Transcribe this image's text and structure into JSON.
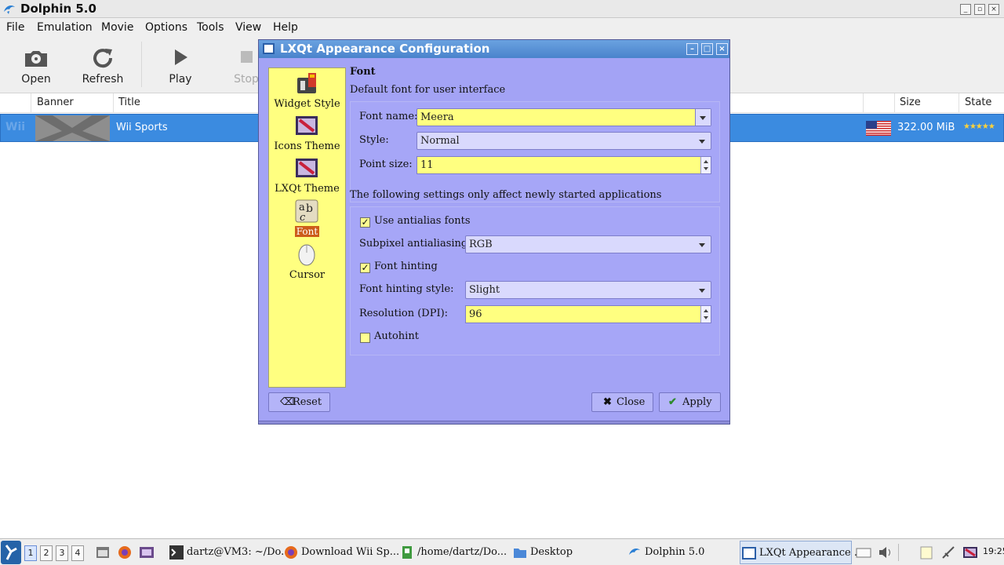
{
  "dolphin": {
    "title": "Dolphin 5.0",
    "menu": [
      "File",
      "Emulation",
      "Movie",
      "Options",
      "Tools",
      "View",
      "Help"
    ],
    "toolbar": {
      "open": "Open",
      "refresh": "Refresh",
      "play": "Play",
      "stop": "Stop"
    },
    "columns": {
      "banner": "Banner",
      "title": "Title",
      "size": "Size",
      "state": "State"
    },
    "games": [
      {
        "banner_text": "Wii",
        "title": "Wii Sports",
        "size": "322.00 MiB",
        "region": "usa-flag-icon",
        "rating_stars": "★★★★★"
      }
    ]
  },
  "dialog": {
    "title": "LXQt Appearance Configuration",
    "sidebar": [
      {
        "label": "Widget Style",
        "icon": "widget-style-icon"
      },
      {
        "label": "Icons Theme",
        "icon": "icons-theme-icon"
      },
      {
        "label": "LXQt Theme",
        "icon": "lxqt-theme-icon"
      },
      {
        "label": "Font",
        "icon": "font-icon",
        "selected": true
      },
      {
        "label": "Cursor",
        "icon": "cursor-icon"
      }
    ],
    "font": {
      "heading": "Font",
      "subheading": "Default font for user interface",
      "font_name_label": "Font name:",
      "font_name_value": "Meera",
      "style_label": "Style:",
      "style_value": "Normal",
      "point_size_label": "Point size:",
      "point_size_value": "11",
      "note": "The following settings only affect newly started applications",
      "antialias_label": "Use antialias fonts",
      "antialias_checked": "✓",
      "subpixel_label": "Subpixel antialiasing:",
      "subpixel_value": "RGB",
      "hinting_label": "Font hinting",
      "hinting_checked": "✓",
      "hinting_style_label": "Font hinting style:",
      "hinting_style_value": "Slight",
      "dpi_label": "Resolution (DPI):",
      "dpi_value": "96",
      "autohint_label": "Autohint"
    },
    "buttons": {
      "reset": "Reset",
      "close": "Close",
      "apply": "Apply"
    }
  },
  "taskbar": {
    "desktops": [
      "1",
      "2",
      "3",
      "4"
    ],
    "tasks": [
      {
        "label": "dartz@VM3: ~/Do...",
        "icon": "terminal-icon"
      },
      {
        "label": "Download Wii Sp...",
        "icon": "firefox-icon"
      },
      {
        "label": "/home/dartz/Do...",
        "icon": "file-icon"
      },
      {
        "label": "Desktop",
        "icon": "folder-icon"
      },
      {
        "label": "Dolphin 5.0",
        "icon": "dolphin-icon"
      },
      {
        "label": "LXQt Appearance ...",
        "icon": "lxqt-app-icon"
      }
    ],
    "clock": "19:25"
  },
  "colors": {
    "dialog_bg": "#a3a3f5",
    "sidebar_bg": "#ffff80",
    "selection": "#3b8be0",
    "sidebar_selected": "#cc5c1a"
  }
}
